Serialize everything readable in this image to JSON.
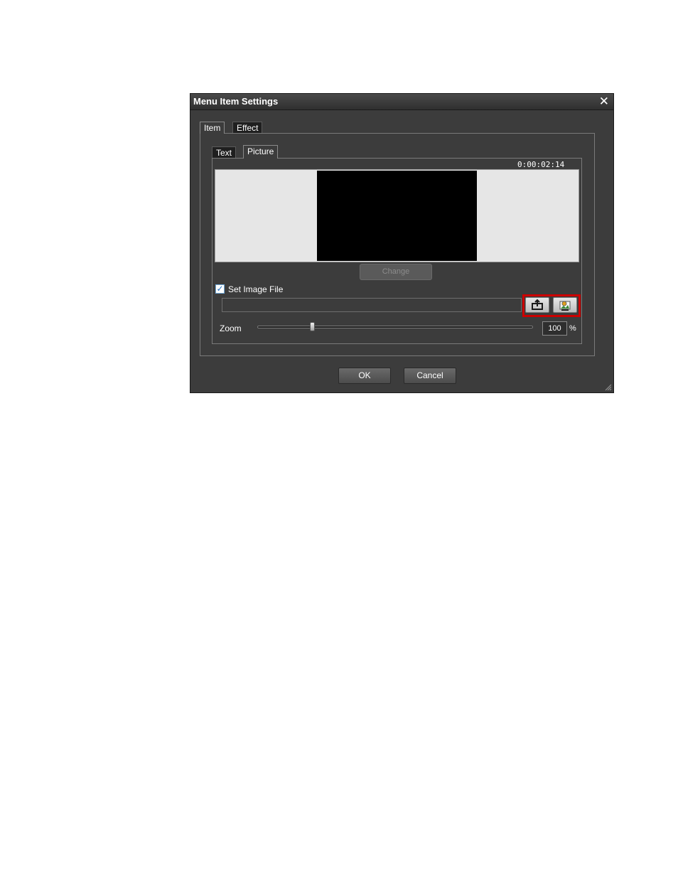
{
  "window": {
    "title": "Menu Item Settings"
  },
  "tabs_top": [
    {
      "label": "Item",
      "active": true
    },
    {
      "label": "Effect",
      "active": false
    }
  ],
  "tabs_sub": [
    {
      "label": "Text",
      "active": false
    },
    {
      "label": "Picture",
      "active": true
    }
  ],
  "preview": {
    "timecode": "0:00:02:14"
  },
  "change_button": {
    "label": "Change",
    "enabled": false
  },
  "set_image": {
    "label": "Set Image File",
    "checked": true,
    "file_path": ""
  },
  "buttons": {
    "import_icon": "folder-import-icon",
    "image_icon": "picture-icon",
    "highlight_color": "#cc0000"
  },
  "zoom": {
    "label": "Zoom",
    "value": "100",
    "unit": "%",
    "level": 0.2
  },
  "footer": {
    "ok_label": "OK",
    "cancel_label": "Cancel"
  }
}
